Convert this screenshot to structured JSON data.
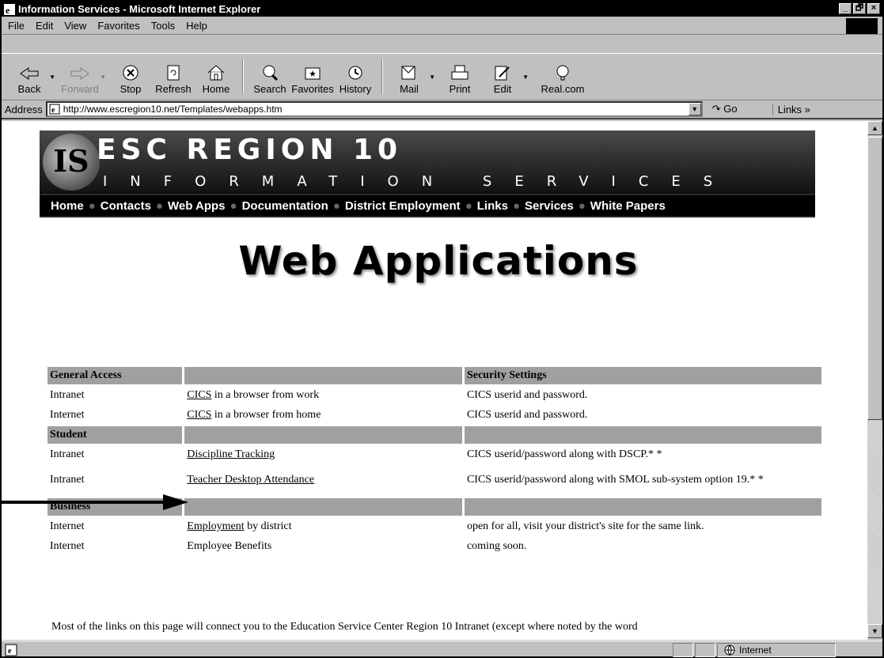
{
  "window": {
    "title": "Information Services - Microsoft Internet Explorer",
    "controls": [
      "_",
      "🗗",
      "×"
    ]
  },
  "menu": [
    "File",
    "Edit",
    "View",
    "Favorites",
    "Tools",
    "Help"
  ],
  "toolbar": [
    {
      "label": "Back",
      "icon": "back-arrow-icon"
    },
    {
      "label": "Forward",
      "icon": "forward-arrow-icon"
    },
    {
      "label": "Stop",
      "icon": "stop-icon"
    },
    {
      "label": "Refresh",
      "icon": "refresh-icon"
    },
    {
      "label": "Home",
      "icon": "home-icon"
    },
    {
      "label": "Search",
      "icon": "search-icon"
    },
    {
      "label": "Favorites",
      "icon": "favorites-icon"
    },
    {
      "label": "History",
      "icon": "history-icon"
    },
    {
      "label": "Mail",
      "icon": "mail-icon"
    },
    {
      "label": "Print",
      "icon": "print-icon"
    },
    {
      "label": "Edit",
      "icon": "edit-icon"
    },
    {
      "label": "Real.com",
      "icon": "real-icon"
    }
  ],
  "address": {
    "label": "Address",
    "url": "http://www.escregion10.net/Templates/webapps.htm",
    "go": "Go",
    "links": "Links »"
  },
  "banner": {
    "logo": "IS",
    "line1": "ESC REGION 10",
    "line2": "INFORMATION SERVICES",
    "nav": [
      "Home",
      "Contacts",
      "Web Apps",
      "Documentation",
      "District Employment",
      "Links",
      "Services",
      "White Papers"
    ]
  },
  "page": {
    "heading": "Web Applications",
    "table": {
      "sections": [
        {
          "title": "General Access",
          "col3": "Security Settings",
          "rows": [
            {
              "net": "Intranet",
              "link": "CICS",
              "rest": " in a browser from work",
              "security": "CICS userid and password."
            },
            {
              "net": "Internet",
              "link": "CICS",
              "rest": " in a browser from home",
              "security": "CICS userid and password."
            }
          ]
        },
        {
          "title": "Student",
          "col3": "",
          "rows": [
            {
              "net": "Intranet",
              "link": "Discipline Tracking",
              "rest": "",
              "security": "CICS userid/password along with DSCP.* *"
            },
            {
              "net": "Intranet",
              "link": "Teacher Desktop Attendance",
              "rest": "",
              "security": "CICS userid/password along with SMOL sub-system option 19.* *"
            }
          ]
        },
        {
          "title": "Business",
          "col3": "",
          "rows": [
            {
              "net": "Internet",
              "link": "Employment",
              "rest": " by district",
              "security": "open for all, visit your district's site for the same link."
            },
            {
              "net": "Internet",
              "link": "",
              "rest": "Employee Benefits",
              "security": "coming soon."
            }
          ]
        }
      ]
    },
    "footer": "Most of the links on this page will connect you to the Education Service Center Region 10 Intranet (except where noted by the word"
  },
  "status": {
    "zone": "Internet"
  }
}
